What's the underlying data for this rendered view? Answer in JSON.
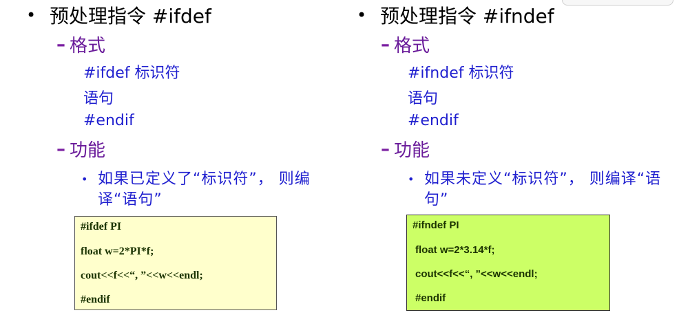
{
  "left": {
    "heading": "预处理指令 #ifdef",
    "format_label": "格式",
    "format_lines": [
      "#ifdef 标识符",
      "语句",
      "#endif"
    ],
    "function_label": "功能",
    "description": "如果已定义了“标识符”， 则编译“语句”",
    "code": [
      "#ifdef PI",
      "float w=2*PI*f;",
      "cout<<f<<“, ”<<w<<endl;",
      "#endif"
    ]
  },
  "right": {
    "heading": "预处理指令 #ifndef",
    "format_label": "格式",
    "format_lines": [
      "#ifndef 标识符",
      "语句",
      "#endif"
    ],
    "function_label": "功能",
    "description": "如果未定义“标识符”， 则编译“语句”",
    "code": [
      "#ifndef PI",
      "float w=2*3.14*f;",
      "cout<<f<<“, ”<<w<<endl;",
      "#endif"
    ]
  },
  "bullet_glyph": "•",
  "dash_glyph": "–",
  "colors": {
    "heading": "#000000",
    "sub_label": "#7b1fa2",
    "body_text": "#1f1fcf",
    "code_box_left": "#ffffcc",
    "code_box_right": "#ccff66"
  }
}
